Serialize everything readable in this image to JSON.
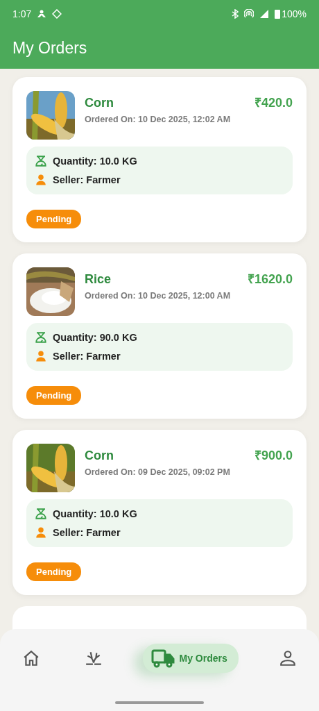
{
  "status_bar": {
    "time": "1:07",
    "battery": "100%"
  },
  "app_bar": {
    "title": "My Orders"
  },
  "orders": [
    {
      "name": "Corn",
      "price": "₹420.0",
      "date": "Ordered On: 10 Dec 2025, 12:02 AM",
      "quantity": "Quantity: 10.0 KG",
      "seller": "Seller: Farmer",
      "status": "Pending"
    },
    {
      "name": "Rice",
      "price": "₹1620.0",
      "date": "Ordered On: 10 Dec 2025, 12:00 AM",
      "quantity": "Quantity: 90.0 KG",
      "seller": "Seller: Farmer",
      "status": "Pending"
    },
    {
      "name": "Corn",
      "price": "₹900.0",
      "date": "Ordered On: 09 Dec 2025, 09:02 PM",
      "quantity": "Quantity: 10.0 KG",
      "seller": "Seller: Farmer",
      "status": "Pending"
    }
  ],
  "nav": [
    {
      "kind": "home",
      "selected": false
    },
    {
      "kind": "crops",
      "selected": false
    },
    {
      "kind": "orders",
      "label": "My Orders",
      "selected": true
    },
    {
      "kind": "profile",
      "selected": false
    }
  ]
}
